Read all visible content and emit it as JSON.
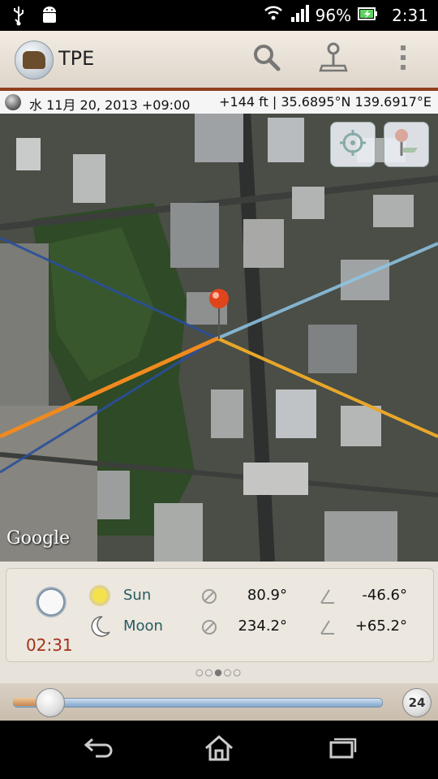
{
  "status_bar": {
    "battery": "96%",
    "time": "2:31",
    "icons": [
      "usb-icon",
      "android-icon",
      "wifi-icon",
      "signal-icon",
      "battery-icon"
    ]
  },
  "app_bar": {
    "title": "TPE",
    "actions": [
      "search-icon",
      "location-pin-icon",
      "overflow-menu-icon"
    ]
  },
  "info_bar": {
    "datetime": "水 11月 20, 2013 +09:00",
    "location": "+144 ft | 35.6895°N 139.6917°E"
  },
  "map": {
    "watermark": "Google",
    "zoom_in": "+",
    "zoom_out": "−",
    "controls": [
      "my-location-icon",
      "pin-icon"
    ],
    "line_colors": {
      "sun_rise": "#f08a1f",
      "sun_set": "#e8a72a",
      "moon_rise": "#2a4f9a",
      "moon_set": "#8fc6e6"
    }
  },
  "panel": {
    "time": "02:31",
    "bodies": [
      {
        "name": "Sun",
        "azimuth": "80.9°",
        "elevation": "-46.6°"
      },
      {
        "name": "Moon",
        "azimuth": "234.2°",
        "elevation": "+65.2°"
      }
    ],
    "page_indicator": "○○●○○"
  },
  "slider": {
    "badge": "24",
    "value_fraction": 0.1
  },
  "nav": {
    "buttons": [
      "back-icon",
      "home-icon",
      "recents-icon"
    ]
  }
}
